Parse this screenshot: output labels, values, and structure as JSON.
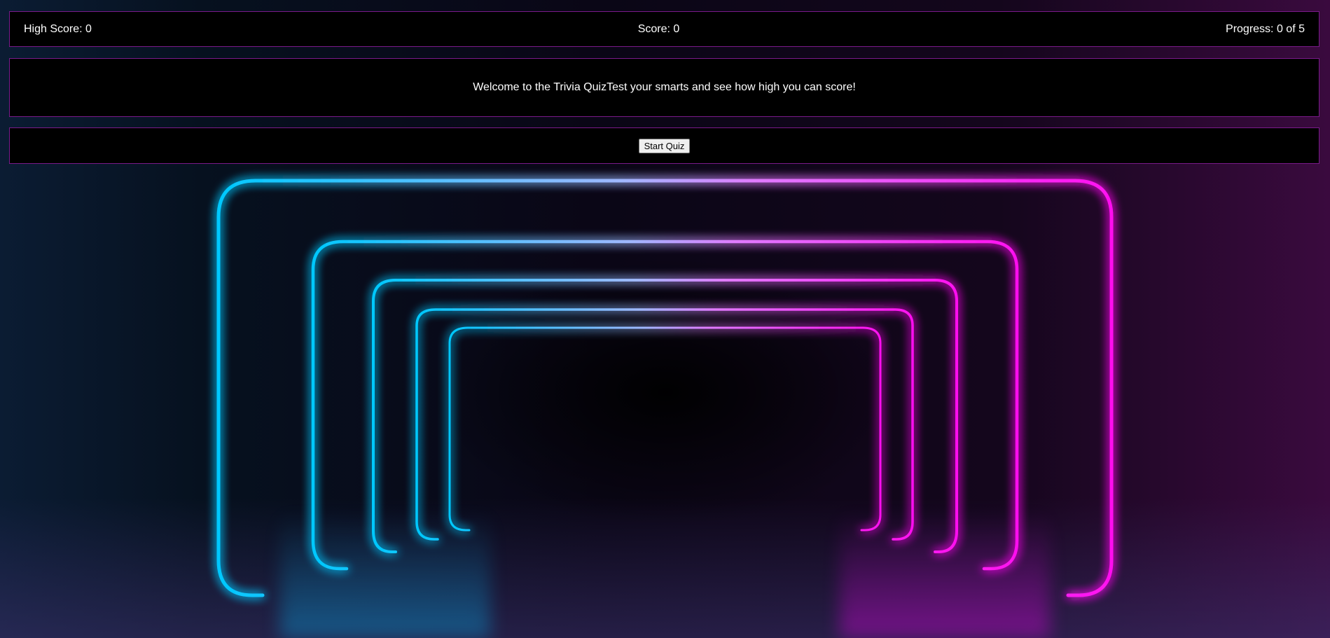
{
  "header": {
    "high_score": "High Score: 0",
    "score": "Score: 0",
    "progress": "Progress: 0 of 5"
  },
  "welcome": {
    "text": "Welcome to the Trivia QuizTest your smarts and see how high you can score!"
  },
  "controls": {
    "start_label": "Start Quiz"
  },
  "colors": {
    "panel_bg": "#000000",
    "panel_border": "#7a1a8a",
    "neon_cyan": "#00c8ff",
    "neon_magenta": "#ff10f0"
  }
}
